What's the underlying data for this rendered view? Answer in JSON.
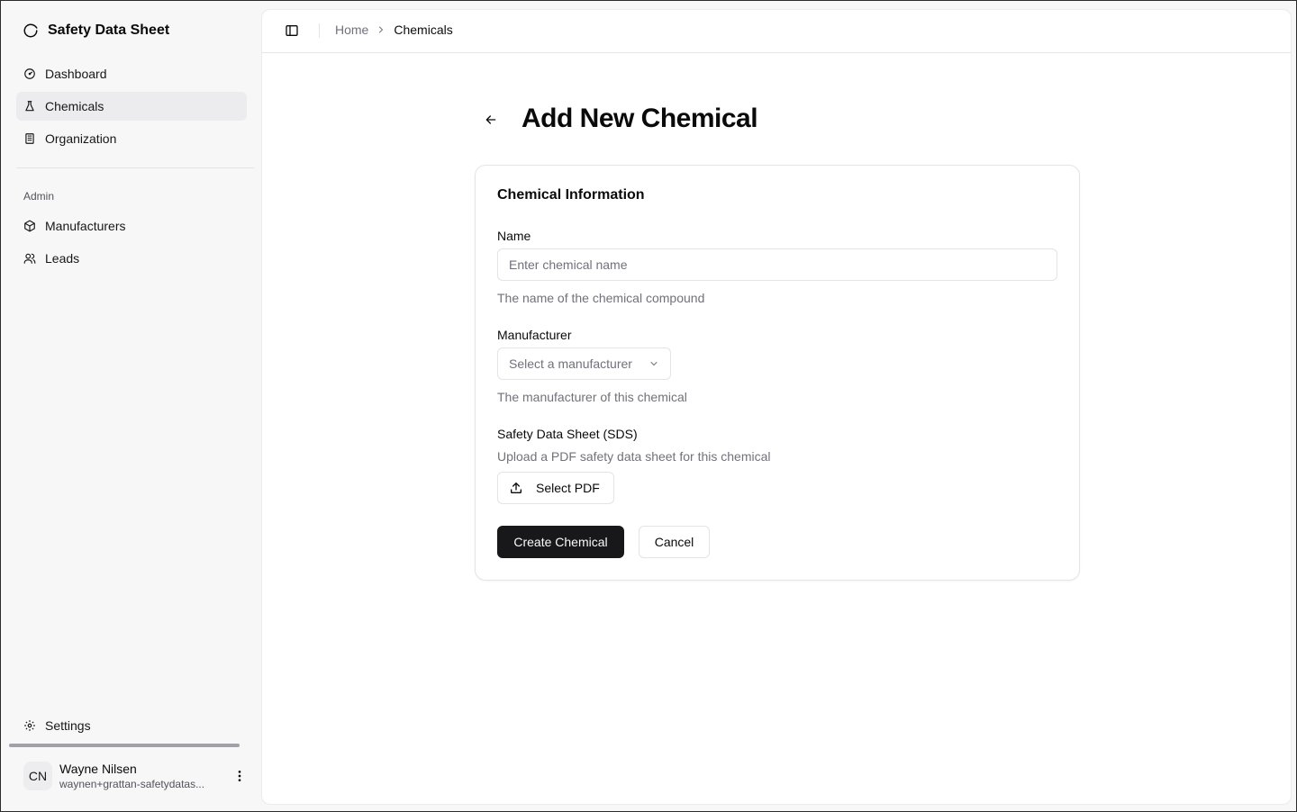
{
  "sidebar": {
    "brand": {
      "title": "Safety Data Sheet",
      "icon": "circle-logo-icon"
    },
    "nav_main": [
      {
        "label": "Dashboard",
        "icon": "gauge-icon",
        "active": false
      },
      {
        "label": "Chemicals",
        "icon": "flask-icon",
        "active": true
      },
      {
        "label": "Organization",
        "icon": "building-icon",
        "active": false
      }
    ],
    "admin_label": "Admin",
    "nav_admin": [
      {
        "label": "Manufacturers",
        "icon": "package-icon"
      },
      {
        "label": "Leads",
        "icon": "users-icon"
      }
    ],
    "settings": {
      "label": "Settings",
      "icon": "gear-icon"
    },
    "user": {
      "initials": "CN",
      "name": "Wayne Nilsen",
      "email": "waynen+grattan-safetydatas..."
    }
  },
  "header": {
    "breadcrumb": {
      "home": "Home",
      "current": "Chemicals"
    }
  },
  "page": {
    "title": "Add New Chemical"
  },
  "form": {
    "card_title": "Chemical Information",
    "name": {
      "label": "Name",
      "placeholder": "Enter chemical name",
      "value": "",
      "help": "The name of the chemical compound"
    },
    "manufacturer": {
      "label": "Manufacturer",
      "placeholder": "Select a manufacturer",
      "help": "The manufacturer of this chemical"
    },
    "sds": {
      "label": "Safety Data Sheet (SDS)",
      "help": "Upload a PDF safety data sheet for this chemical",
      "button": "Select PDF"
    },
    "submit_label": "Create Chemical",
    "cancel_label": "Cancel"
  },
  "colors": {
    "primary": "#18181b",
    "sidebar_bg": "#f7f7f8",
    "muted_text": "#71717a"
  }
}
